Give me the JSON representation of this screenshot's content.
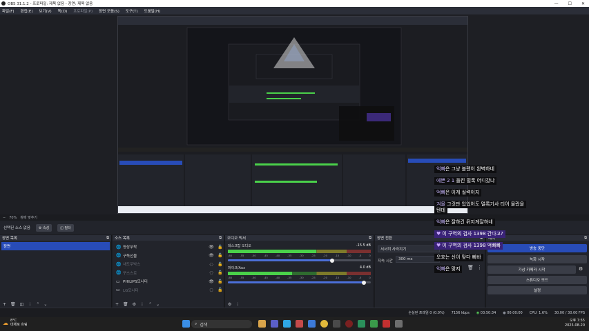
{
  "window": {
    "title": "OBS 31.1.2 - 프로파일: 제목 없음 - 장면: 제목 없음",
    "minimize": "—",
    "maximize": "☐",
    "close": "✕"
  },
  "menu": {
    "items": [
      {
        "label": "파일(F)",
        "disabled": false
      },
      {
        "label": "편집(E)",
        "disabled": false
      },
      {
        "label": "보기(V)",
        "disabled": false
      },
      {
        "label": "독(D)",
        "disabled": false
      },
      {
        "label": "프로파일(P)",
        "disabled": true
      },
      {
        "label": "장면 모음(S)",
        "disabled": false
      },
      {
        "label": "도구(T)",
        "disabled": false
      },
      {
        "label": "도움말(H)",
        "disabled": false
      }
    ]
  },
  "zoom": {
    "value": "70%",
    "mode": "창에 맞추기"
  },
  "source_toolbar": {
    "no_source": "선택된 소스 없음",
    "properties": "속성",
    "filters": "필터"
  },
  "scenes": {
    "title": "장면 목록",
    "items": [
      {
        "label": "장면",
        "selected": true
      }
    ]
  },
  "sources": {
    "title": "소스 목록",
    "items": [
      {
        "label": "영상부착",
        "icon": "🌐",
        "hidden": false
      },
      {
        "label": "구독선물",
        "icon": "🌐",
        "hidden": false
      },
      {
        "label": "새도우박스",
        "icon": "🌐",
        "hidden": true
      },
      {
        "label": "꾸스스로",
        "icon": "🌐",
        "hidden": true
      },
      {
        "label": "PHILIPS모니터",
        "icon": "▭",
        "hidden": false
      },
      {
        "label": "LG모니터",
        "icon": "▭",
        "hidden": true
      }
    ]
  },
  "mixer": {
    "title": "오디오 믹서",
    "channels": [
      {
        "name": "데스크탑 오디오",
        "db": "-15.5 dB",
        "level": 0.62,
        "fader": 0.73
      },
      {
        "name": "마이크/Aux",
        "db": "4.0 dB",
        "level": 0.45,
        "fader": 0.95
      }
    ],
    "ticks": [
      "-60",
      "-55",
      "-50",
      "-45",
      "-40",
      "-35",
      "-30",
      "-25",
      "-20",
      "-15",
      "-10",
      "-5",
      "0"
    ]
  },
  "transitions": {
    "title": "장면 전환",
    "type": "서서히 사라지기",
    "duration_label": "지속 시간",
    "duration": "300 ms"
  },
  "controls": {
    "title": "제어",
    "stream": "방송 중단",
    "record": "녹화 시작",
    "virtual_cam": "가상 카메라 시작",
    "studio": "스튜디오 모드",
    "settings": "설정"
  },
  "chat": [
    {
      "hl": "억빠",
      "text": "은 그냥 블랜이 완벽하네",
      "purple": false
    },
    {
      "hl": "에쁜 2 1",
      "text": " 들킨 멀록 어디갔냐",
      "purple": false
    },
    {
      "hl": "억빠",
      "text": "은 이게 실력이지",
      "purple": false
    },
    {
      "hl": "겨울",
      "text": " 그것만 있었어도 멀록기사 티어 올랐을",
      "purple": false
    },
    {
      "hl": "",
      "text": "텐데",
      "purple": false
    },
    {
      "hl": "억빠",
      "text": "은 잘하긴 뒤지게잘하네",
      "purple": false
    },
    {
      "hl": "",
      "text": "이 구역의 검사 1398 간다고?",
      "purple": true
    },
    {
      "hl": "",
      "text": "이 구역의 검사 1398 억빠빠",
      "purple": true
    },
    {
      "hl": "",
      "text": "오호는 신이 맞다 빠바",
      "purple": false
    },
    {
      "hl": "억빠",
      "text": "은 맞저",
      "purple": false
    }
  ],
  "status": {
    "dropped": "손실된 프레임 0 (0.0%)",
    "bitrate": "7156 kbps",
    "live_time": "03:50:34",
    "rec_time": "00:00:00",
    "cpu": "CPU: 1.6%",
    "fps": "30.00 / 30.00 FPS"
  },
  "taskbar": {
    "weather_temp": "8°C",
    "weather_desc": "대체로 흐림",
    "search": "검색",
    "time": "오후 7:55",
    "date": "2025-08-20"
  }
}
